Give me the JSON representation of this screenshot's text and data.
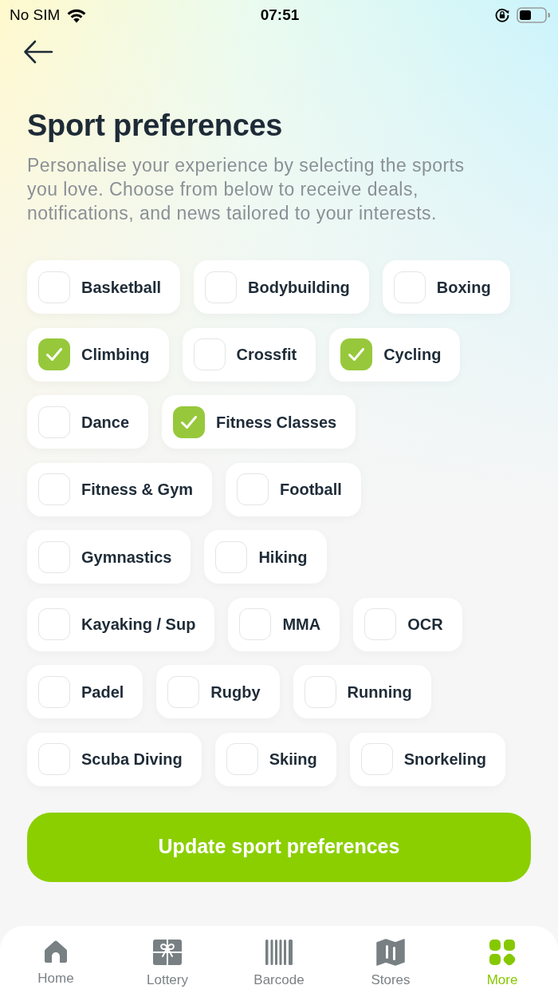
{
  "status_bar": {
    "carrier": "No SIM",
    "time": "07:51"
  },
  "header": {
    "title": "Sport preferences",
    "subtitle": "Personalise your experience by selecting the sports you love. Choose from below to receive deals, notifications, and news tailored to your interests."
  },
  "sport_rows": [
    [
      {
        "label": "Basketball",
        "checked": false
      },
      {
        "label": "Bodybuilding",
        "checked": false
      },
      {
        "label": "Boxing",
        "checked": false
      }
    ],
    [
      {
        "label": "Climbing",
        "checked": true
      },
      {
        "label": "Crossfit",
        "checked": false
      },
      {
        "label": "Cycling",
        "checked": true
      }
    ],
    [
      {
        "label": "Dance",
        "checked": false
      },
      {
        "label": "Fitness Classes",
        "checked": true
      }
    ],
    [
      {
        "label": "Fitness & Gym",
        "checked": false
      },
      {
        "label": "Football",
        "checked": false
      }
    ],
    [
      {
        "label": "Gymnastics",
        "checked": false
      },
      {
        "label": "Hiking",
        "checked": false
      }
    ],
    [
      {
        "label": "Kayaking / Sup",
        "checked": false
      },
      {
        "label": "MMA",
        "checked": false
      },
      {
        "label": "OCR",
        "checked": false
      }
    ],
    [
      {
        "label": "Padel",
        "checked": false
      },
      {
        "label": "Rugby",
        "checked": false
      },
      {
        "label": "Running",
        "checked": false
      }
    ],
    [
      {
        "label": "Scuba Diving",
        "checked": false
      },
      {
        "label": "Skiing",
        "checked": false
      },
      {
        "label": "Snorkeling",
        "checked": false
      }
    ]
  ],
  "update_button": {
    "label": "Update sport preferences"
  },
  "tab_bar": [
    {
      "label": "Home",
      "kind": "home",
      "selected": false
    },
    {
      "label": "Lottery",
      "kind": "gift",
      "selected": false
    },
    {
      "label": "Barcode",
      "kind": "barcode",
      "selected": false
    },
    {
      "label": "Stores",
      "kind": "map",
      "selected": false
    },
    {
      "label": "More",
      "kind": "grid",
      "selected": true
    }
  ]
}
